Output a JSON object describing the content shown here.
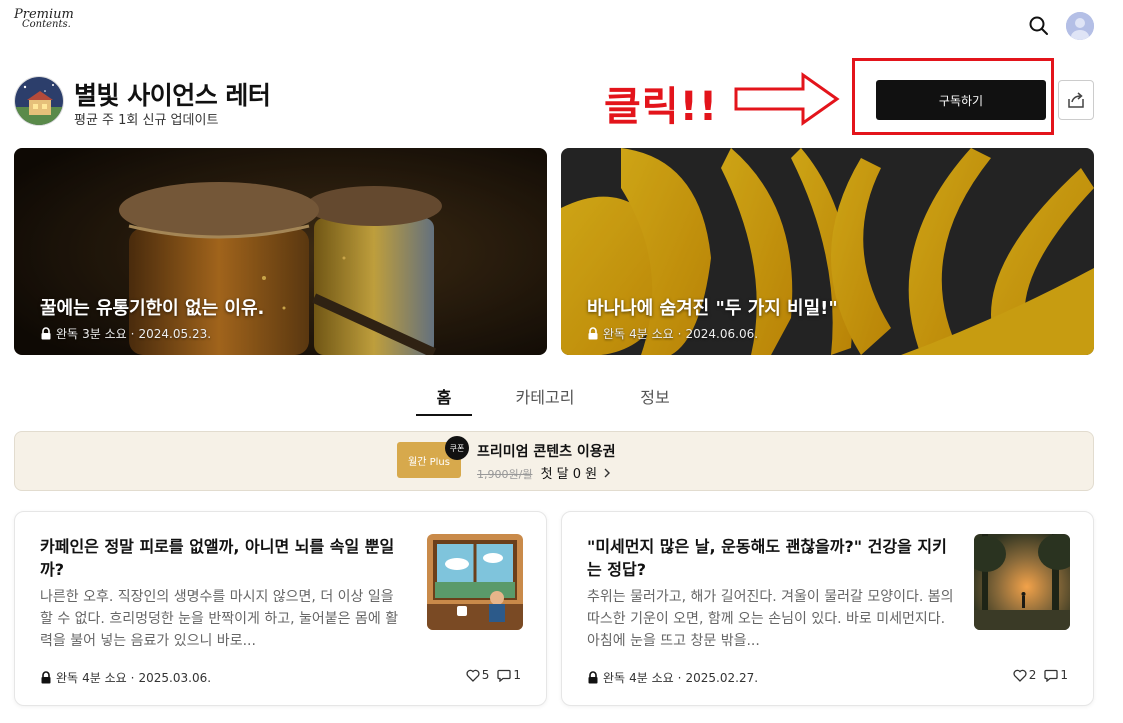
{
  "header": {
    "logo_line1": "Premium",
    "logo_line2": "Contents."
  },
  "channel": {
    "title": "별빛 사이언스 레터",
    "subtitle": "평균 주 1회 신규 업데이트",
    "subscribe_label": "구독하기"
  },
  "annotation": {
    "text": "클릭!!",
    "color": "#e3141b"
  },
  "featured": [
    {
      "title": "꿀에는 유통기한이 없는 이유.",
      "status": "완독",
      "read_time": "3분 소요",
      "date": "2024.05.23."
    },
    {
      "title": "바나나에 숨겨진 \"두 가지 비밀!\"",
      "status": "완독",
      "read_time": "4분 소요",
      "date": "2024.06.06."
    }
  ],
  "tabs": [
    {
      "label": "홈"
    },
    {
      "label": "카테고리"
    },
    {
      "label": "정보"
    }
  ],
  "coupon": {
    "card_label": "월간 Plus",
    "badge": "쿠폰",
    "title": "프리미엄 콘텐츠 이용권",
    "original_price": "1,900원/월",
    "offer": "첫 달 0 원"
  },
  "posts": [
    {
      "title": "카페인은 정말 피로를 없앨까, 아니면 뇌를 속일 뿐일까?",
      "excerpt": "나른한 오후. 직장인의 생명수를 마시지 않으면, 더 이상 일을 할 수 없다. 흐리멍덩한 눈을 반짝이게 하고, 눌어붙은 몸에 활력을 불어 넣는 음료가 있으니 바로...",
      "status": "완독",
      "read_time": "4분 소요",
      "date": "2025.03.06.",
      "likes": "5",
      "comments": "1"
    },
    {
      "title": "\"미세먼지 많은 날, 운동해도 괜찮을까?\" 건강을 지키는 정답?",
      "excerpt": "추위는 물러가고, 해가 길어진다. 겨울이 물러갈 모양이다. 봄의 따스한 기운이 오면, 함께 오는 손님이 있다. 바로 미세먼지다. 아침에 눈을 뜨고 창문 밖을...",
      "status": "완독",
      "read_time": "4분 소요",
      "date": "2025.02.27.",
      "likes": "2",
      "comments": "1"
    }
  ],
  "icons": {
    "search": "search-icon",
    "avatar": "user-avatar",
    "share": "share-icon",
    "lock": "lock-icon",
    "heart": "heart-icon",
    "comment": "comment-icon",
    "chevron": "chevron-right-icon"
  }
}
